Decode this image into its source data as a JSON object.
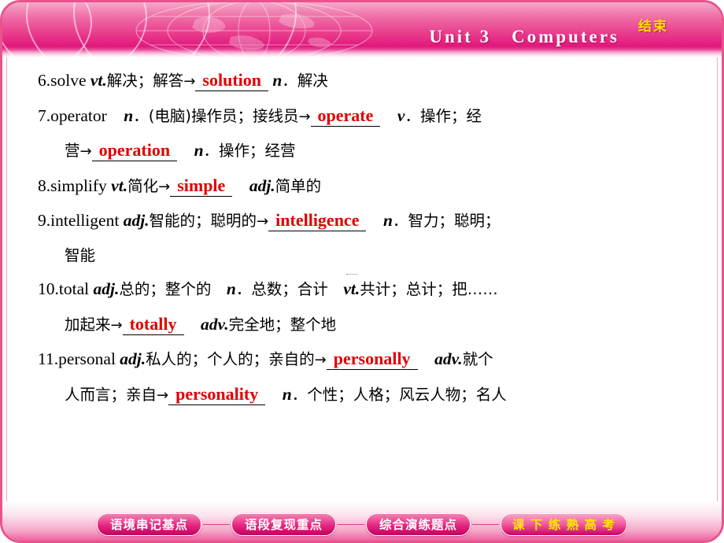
{
  "header": {
    "title": "Unit 3　Computers",
    "end_button": "结束",
    "icons": {
      "globe": "globe-icon",
      "swirl": "swirl-decoration-icon"
    }
  },
  "content": {
    "lines": [
      {
        "id": "item-6",
        "parts": [
          {
            "type": "text",
            "text": "6.solve "
          },
          {
            "type": "italic",
            "text": "vt."
          },
          {
            "type": "cn",
            "text": "解决；解答"
          },
          {
            "type": "arrow",
            "text": "→"
          },
          {
            "type": "answer",
            "text": "solution"
          },
          {
            "type": "italic",
            "text": " n"
          },
          {
            "type": "cn",
            "text": "．解决"
          }
        ]
      },
      {
        "id": "item-7",
        "parts": [
          {
            "type": "text",
            "text": "7.operator　"
          },
          {
            "type": "italic",
            "text": "n"
          },
          {
            "type": "cn",
            "text": "．(电脑)操作员；接线员"
          },
          {
            "type": "arrow",
            "text": "→"
          },
          {
            "type": "answer",
            "text": "operate"
          },
          {
            "type": "italic",
            "text": "　v"
          },
          {
            "type": "cn",
            "text": "．操作；经"
          }
        ]
      },
      {
        "id": "item-7b",
        "indent": true,
        "parts": [
          {
            "type": "cn",
            "text": "营"
          },
          {
            "type": "arrow",
            "text": "→"
          },
          {
            "type": "answer",
            "text": "operation"
          },
          {
            "type": "italic",
            "text": "　n"
          },
          {
            "type": "cn",
            "text": "．操作；经营"
          }
        ]
      },
      {
        "id": "item-8",
        "parts": [
          {
            "type": "text",
            "text": "8.simplify "
          },
          {
            "type": "italic",
            "text": "vt."
          },
          {
            "type": "cn",
            "text": "简化"
          },
          {
            "type": "arrow",
            "text": "→"
          },
          {
            "type": "answer",
            "text": "simple"
          },
          {
            "type": "italic",
            "text": "　adj."
          },
          {
            "type": "cn",
            "text": "简单的"
          }
        ]
      },
      {
        "id": "item-9",
        "parts": [
          {
            "type": "text",
            "text": "9.intelligent "
          },
          {
            "type": "italic",
            "text": "adj."
          },
          {
            "type": "cn",
            "text": "智能的；聪明的"
          },
          {
            "type": "arrow",
            "text": "→"
          },
          {
            "type": "answer",
            "text": "intelligence"
          },
          {
            "type": "italic",
            "text": "　n"
          },
          {
            "type": "cn",
            "text": "．智力；聪明；"
          }
        ]
      },
      {
        "id": "item-9b",
        "indent": true,
        "parts": [
          {
            "type": "cn",
            "text": "智能"
          }
        ]
      },
      {
        "id": "item-10",
        "parts": [
          {
            "type": "text",
            "text": "10.total "
          },
          {
            "type": "italic",
            "text": "adj."
          },
          {
            "type": "cn",
            "text": "总的；整个的　"
          },
          {
            "type": "italic",
            "text": "n"
          },
          {
            "type": "cn",
            "text": "．总数；合计　"
          },
          {
            "type": "italic",
            "text": "vt."
          },
          {
            "type": "cn",
            "text": "共计；总计；把……"
          }
        ]
      },
      {
        "id": "item-10b",
        "indent": true,
        "parts": [
          {
            "type": "cn",
            "text": "加起来"
          },
          {
            "type": "arrow",
            "text": "→"
          },
          {
            "type": "answer",
            "text": "totally"
          },
          {
            "type": "italic",
            "text": "　adv."
          },
          {
            "type": "cn",
            "text": "完全地；整个地"
          }
        ]
      },
      {
        "id": "item-11",
        "parts": [
          {
            "type": "text",
            "text": "11.personal "
          },
          {
            "type": "italic",
            "text": "adj."
          },
          {
            "type": "cn",
            "text": "私人的；个人的；亲自的"
          },
          {
            "type": "arrow",
            "text": "→"
          },
          {
            "type": "answer",
            "text": "personally"
          },
          {
            "type": "italic",
            "text": "　adv."
          },
          {
            "type": "cn",
            "text": "就个"
          }
        ]
      },
      {
        "id": "item-11b",
        "indent": true,
        "parts": [
          {
            "type": "cn",
            "text": "人而言；亲自"
          },
          {
            "type": "arrow",
            "text": "→"
          },
          {
            "type": "answer",
            "text": "personality"
          },
          {
            "type": "italic",
            "text": "　n"
          },
          {
            "type": "cn",
            "text": "．个性；人格；风云人物；名人"
          }
        ]
      }
    ]
  },
  "footer": {
    "tabs": [
      {
        "label": "语境串记基点",
        "active": false
      },
      {
        "label": "语段复现重点",
        "active": false
      },
      {
        "label": "综合演练题点",
        "active": false
      },
      {
        "label": "课 下 练 熟 高 考",
        "active": true
      }
    ]
  },
  "colors": {
    "accent_pink": "#e5267f",
    "answer_red": "#e00000",
    "end_yellow": "#ffe000",
    "title_white": "#ffffff"
  }
}
